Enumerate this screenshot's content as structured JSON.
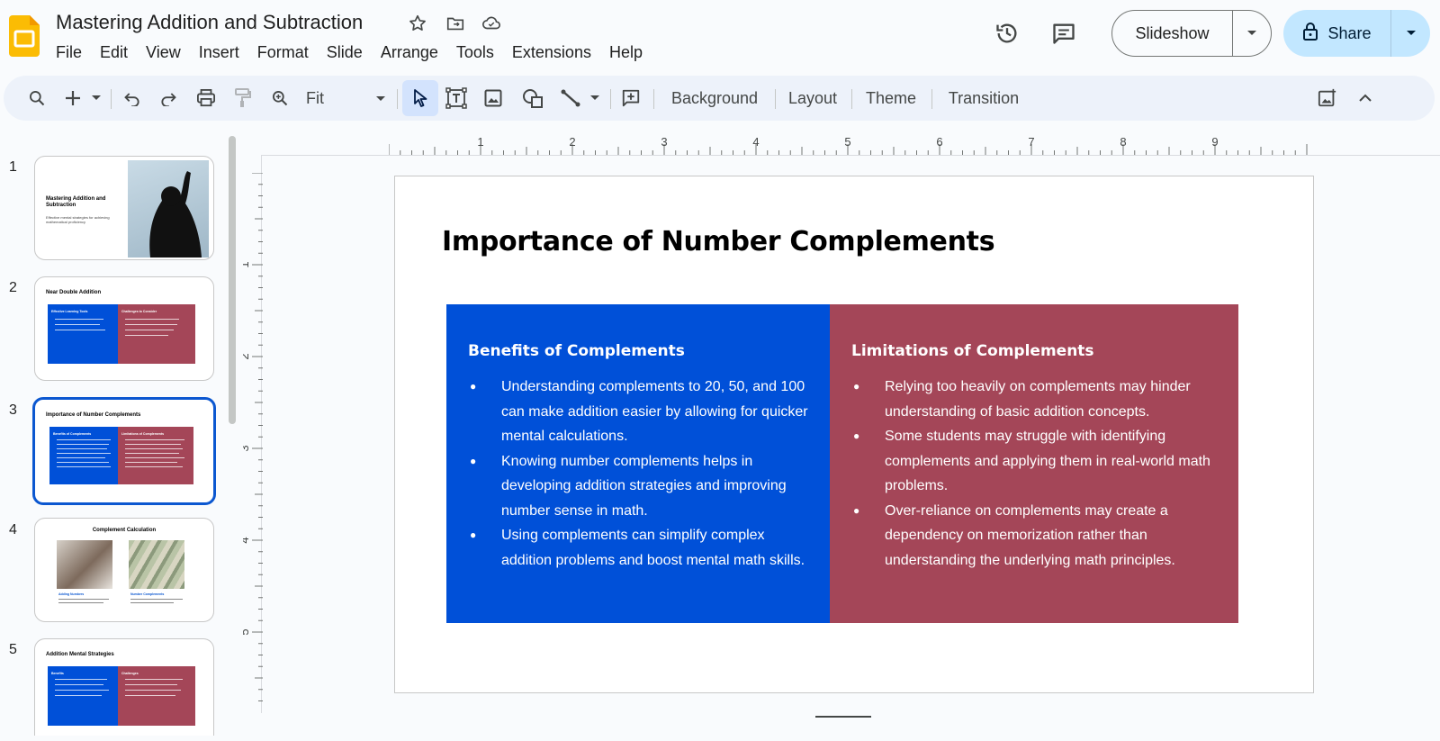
{
  "app": {
    "doc_title": "Mastering Addition and Subtraction",
    "icons": [
      "star-icon",
      "move-to-folder-icon",
      "cloud-saved-icon"
    ]
  },
  "menu": [
    "File",
    "Edit",
    "View",
    "Insert",
    "Format",
    "Slide",
    "Arrange",
    "Tools",
    "Extensions",
    "Help"
  ],
  "header_actions": {
    "slideshow_label": "Slideshow",
    "share_label": "Share"
  },
  "toolbar": {
    "zoom_value": "Fit",
    "background_label": "Background",
    "layout_label": "Layout",
    "theme_label": "Theme",
    "transition_label": "Transition"
  },
  "filmstrip": [
    {
      "num": "1",
      "title": "Mastering Addition and Subtraction",
      "subtitle": "Effective mental strategies for achieving mathematical proficiency"
    },
    {
      "num": "2",
      "title": "Near Double Addition",
      "left_head": "Effective Learning Tools",
      "right_head": "Challenges to Consider"
    },
    {
      "num": "3",
      "title": "Importance of Number Complements",
      "left_head": "Benefits of Complements",
      "right_head": "Limitations of Complements",
      "selected": true
    },
    {
      "num": "4",
      "title": "Complement Calculation",
      "left_caption": "Adding Numbers",
      "right_caption": "Number Complements"
    },
    {
      "num": "5",
      "title": "Addition Mental Strategies",
      "left_head": "Benefits",
      "right_head": "Challenges"
    }
  ],
  "ruler": {
    "h_labels": [
      "1",
      "2",
      "3",
      "4",
      "5",
      "6",
      "7",
      "8",
      "9"
    ],
    "v_labels": [
      "1",
      "2",
      "3",
      "4",
      "5"
    ]
  },
  "slide": {
    "title": "Importance of Number Complements",
    "left": {
      "heading": "Benefits of Complements",
      "bullets": [
        "Understanding complements to 20, 50, and 100 can make addition easier by allowing for quicker mental calculations.",
        "Knowing number complements helps in developing addition strategies and improving number sense in math.",
        "Using complements can simplify complex addition problems and boost mental math skills."
      ]
    },
    "right": {
      "heading": "Limitations of Complements",
      "bullets": [
        "Relying too heavily on complements may hinder understanding of basic addition concepts.",
        "Some students may struggle with identifying complements and applying them in real-world math problems.",
        "Over-reliance on complements may create a dependency on memorization rather than understanding the underlying math principles."
      ]
    }
  },
  "colors": {
    "accent": "#0b57d0",
    "panel_blue": "#0050d8",
    "panel_red": "#a44658",
    "share_bg": "#c2e7ff",
    "toolbar_bg": "#edf2fa"
  }
}
